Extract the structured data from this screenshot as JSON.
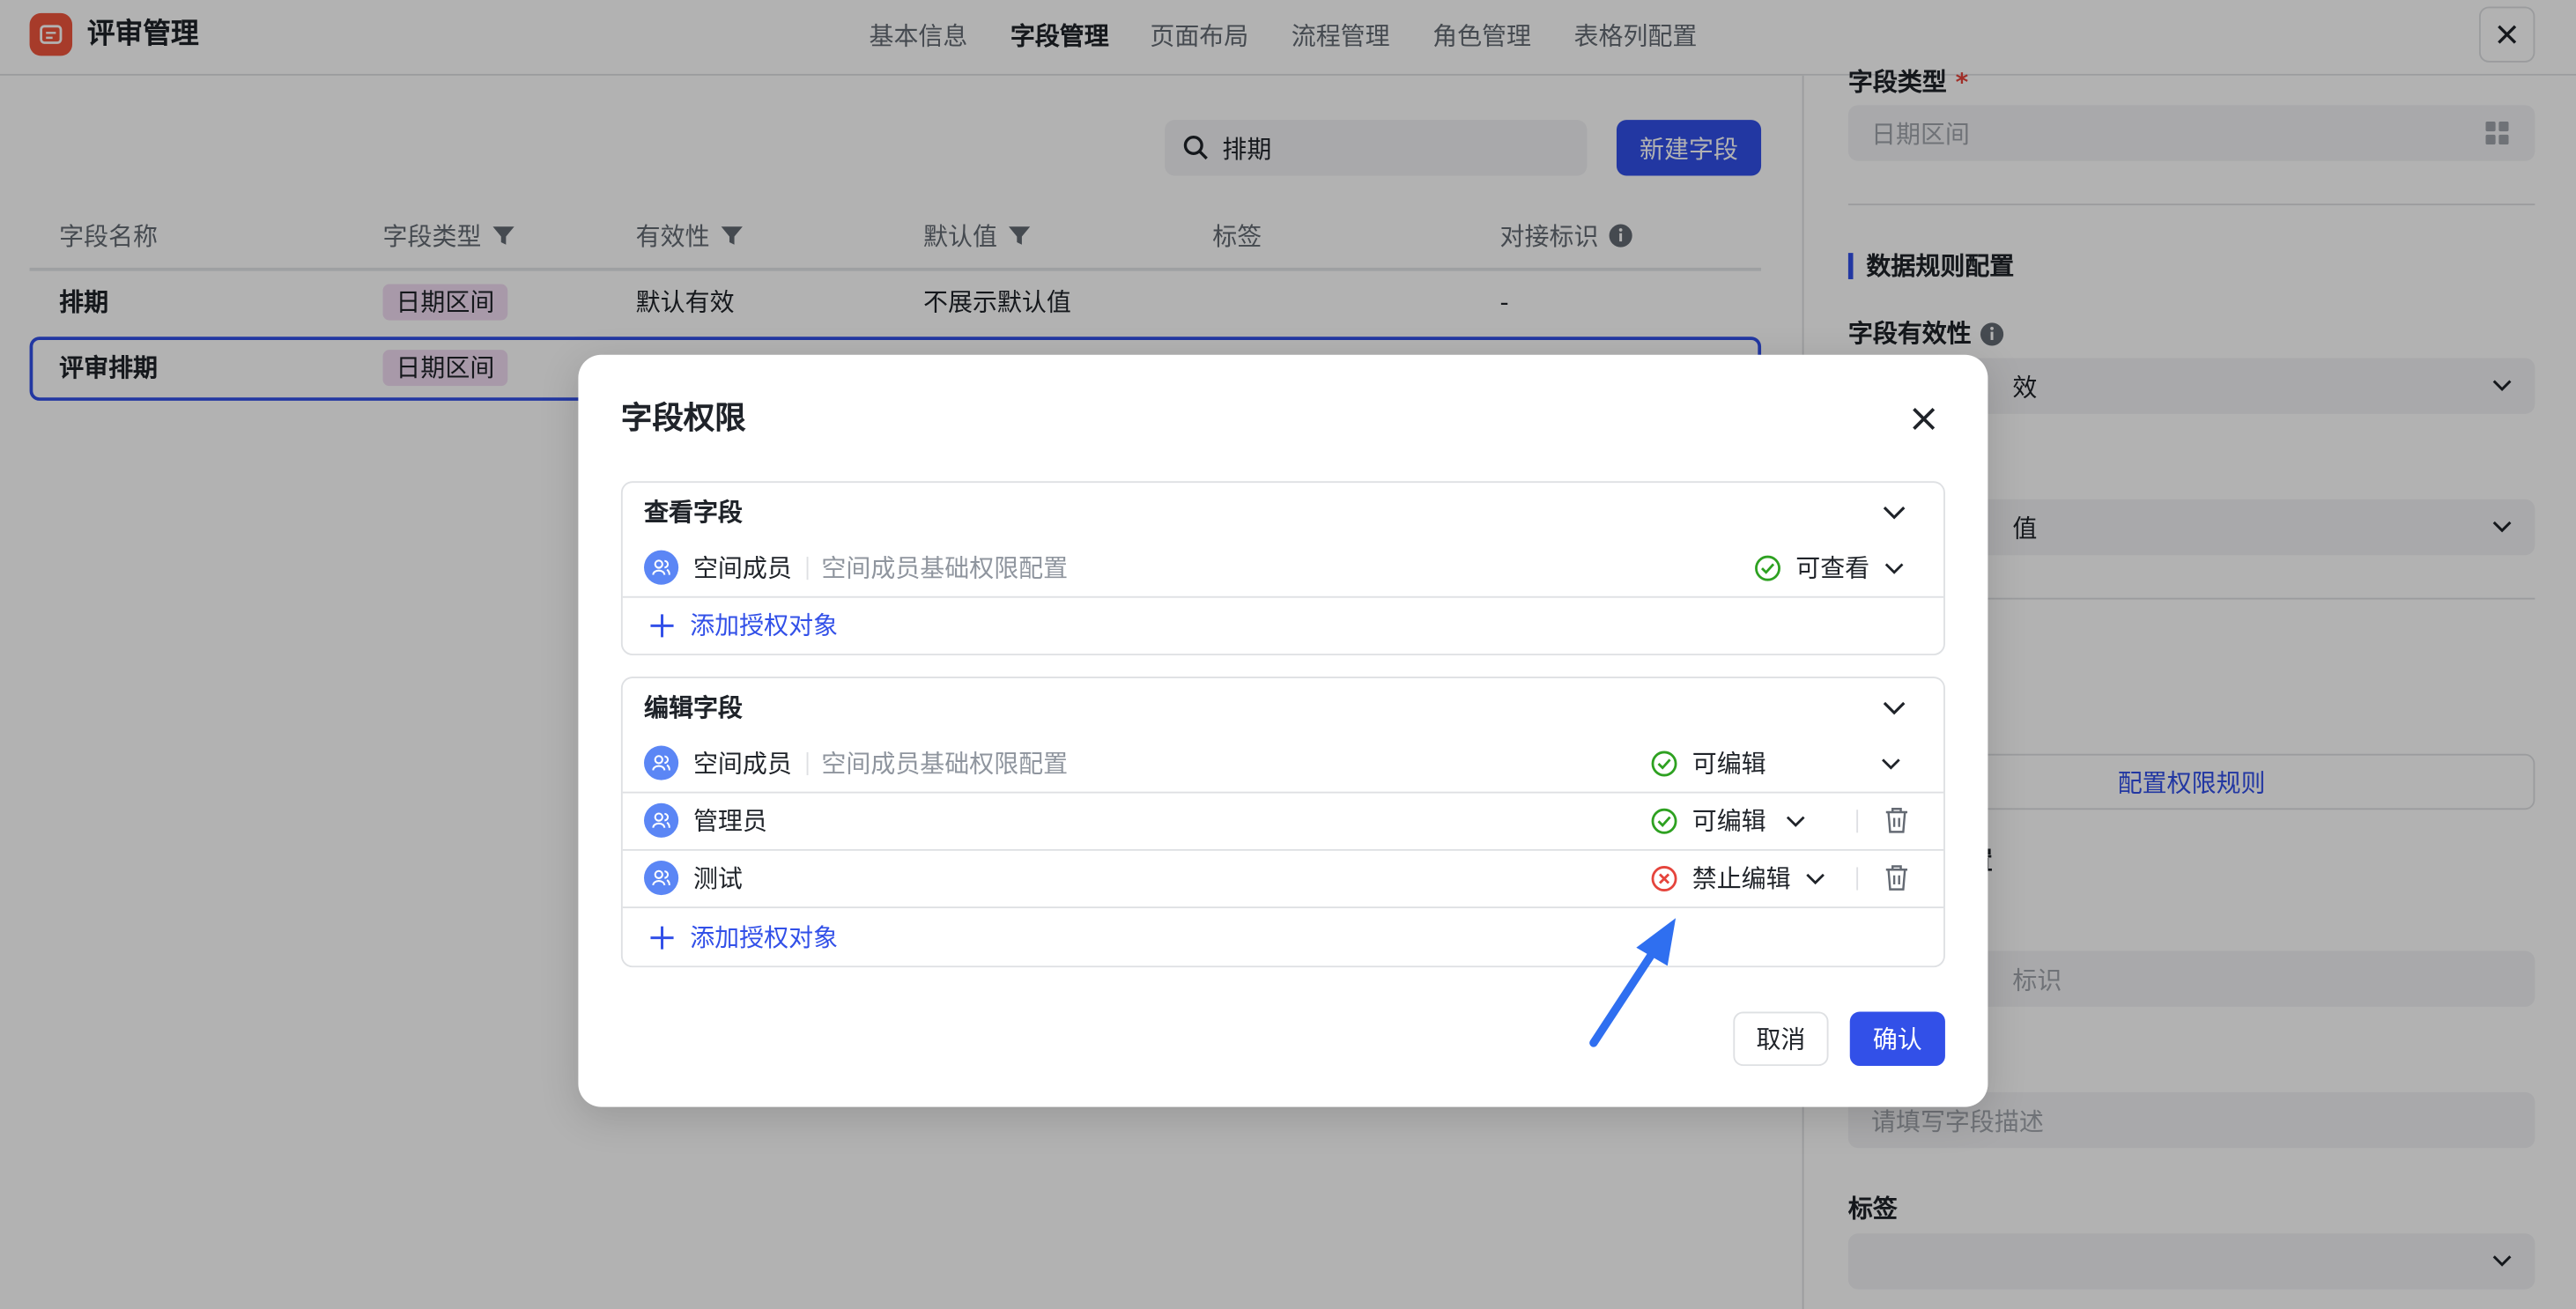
{
  "app": {
    "title": "评审管理"
  },
  "nav": {
    "tabs": [
      {
        "label": "基本信息"
      },
      {
        "label": "字段管理"
      },
      {
        "label": "页面布局"
      },
      {
        "label": "流程管理"
      },
      {
        "label": "角色管理"
      },
      {
        "label": "表格列配置"
      }
    ],
    "active_tab": "字段管理"
  },
  "toolbar": {
    "search_value": "排期",
    "new_field_label": "新建字段"
  },
  "table": {
    "columns": [
      {
        "label": "字段名称"
      },
      {
        "label": "字段类型"
      },
      {
        "label": "有效性"
      },
      {
        "label": "默认值"
      },
      {
        "label": "标签"
      },
      {
        "label": "对接标识"
      }
    ],
    "rows": [
      {
        "name": "排期",
        "type": "日期区间",
        "validity": "默认有效",
        "default": "不展示默认值",
        "tags": "",
        "key": "-"
      },
      {
        "name": "评审排期",
        "type": "日期区间",
        "validity": "",
        "default": "",
        "tags": "",
        "key": ""
      }
    ]
  },
  "right_panel": {
    "field_type_label": "字段类型",
    "required_mark": "*",
    "field_type_value": "日期区间",
    "section_title": "数据规则配置",
    "validity_label": "字段有效性",
    "validity_value_partial": "效",
    "default_value_partial": "值",
    "config_rule_button": "配置权限规则",
    "section2_partial": "置",
    "key_placeholder_partial": "标识",
    "desc_placeholder": "请填写字段描述",
    "tags_label": "标签"
  },
  "modal": {
    "title": "字段权限",
    "view_section": {
      "title": "查看字段",
      "rows": [
        {
          "name": "空间成员",
          "desc": "空间成员基础权限配置",
          "perm": "可查看",
          "status": "allowed"
        }
      ],
      "add_label": "添加授权对象"
    },
    "edit_section": {
      "title": "编辑字段",
      "rows": [
        {
          "name": "空间成员",
          "desc": "空间成员基础权限配置",
          "perm": "可编辑",
          "status": "allowed"
        },
        {
          "name": "管理员",
          "desc": "",
          "perm": "可编辑",
          "status": "allowed"
        },
        {
          "name": "测试",
          "desc": "",
          "perm": "禁止编辑",
          "status": "denied"
        }
      ],
      "add_label": "添加授权对象"
    },
    "cancel_label": "取消",
    "confirm_label": "确认"
  },
  "colors": {
    "primary": "#3250e8",
    "allowed": "#2ea121",
    "denied": "#e5443c",
    "tag_bg": "#f1dcf2",
    "arrow": "#2f6ff0"
  }
}
